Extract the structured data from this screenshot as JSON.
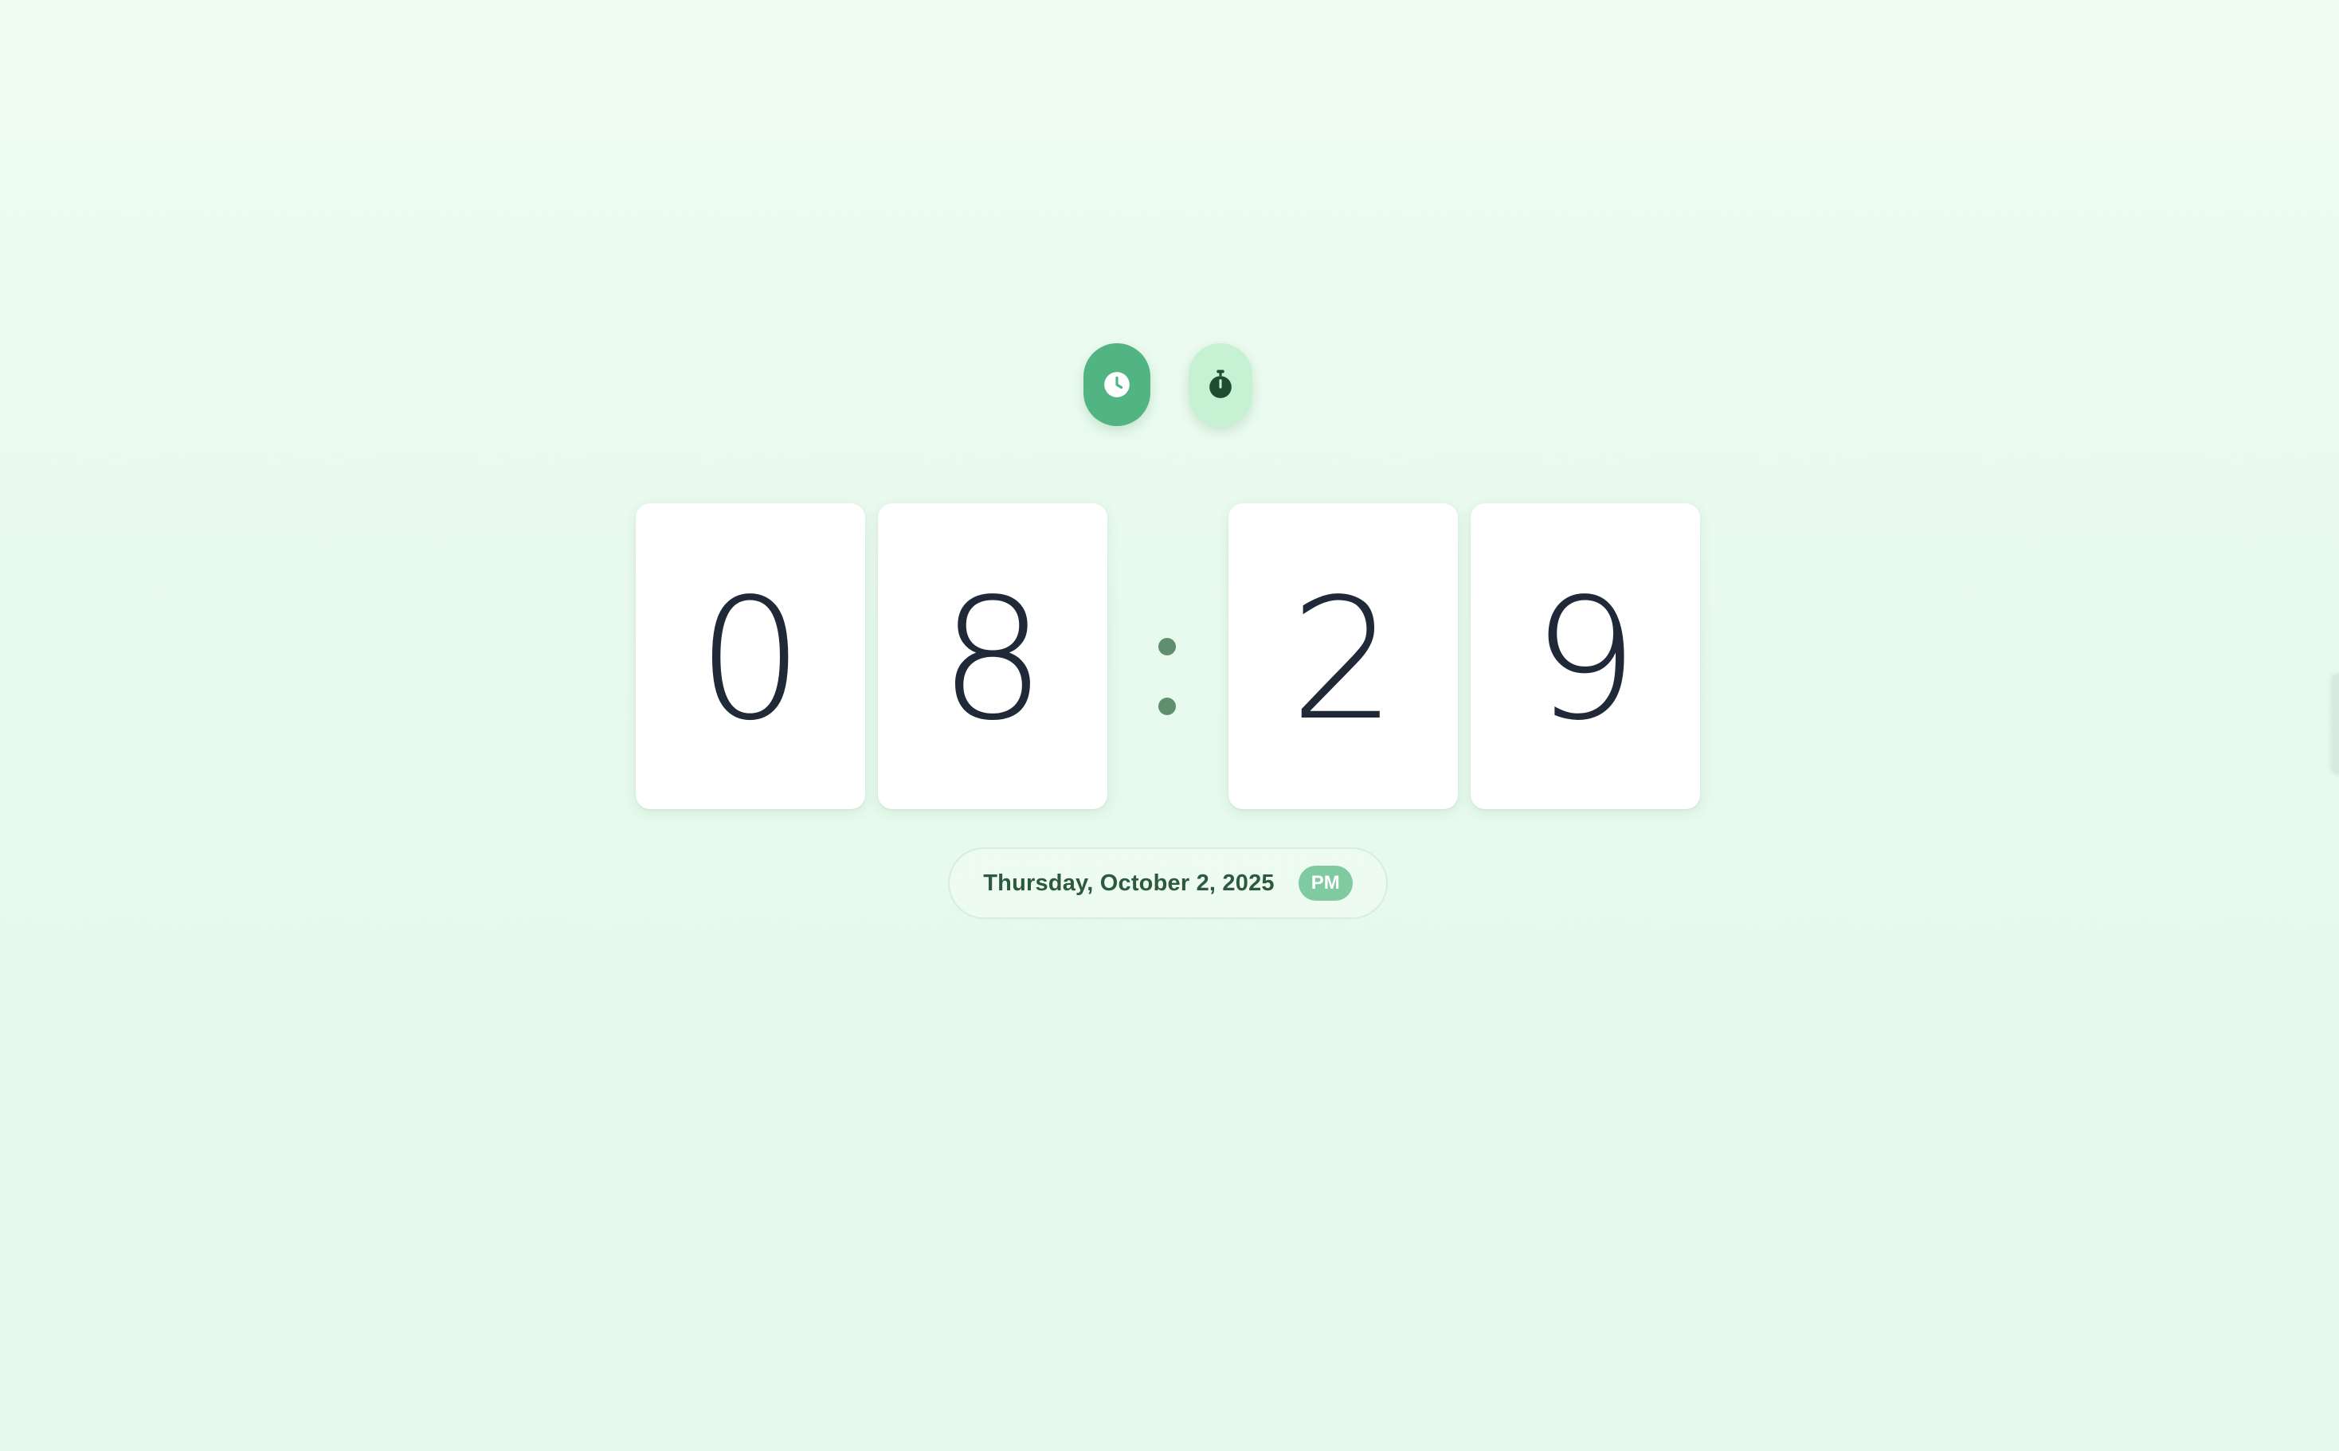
{
  "modes": {
    "clock": {
      "icon": "clock-icon",
      "active": true,
      "color": "#52b483"
    },
    "stopwatch": {
      "icon": "stopwatch-icon",
      "active": false,
      "color": "#c6f2d3"
    }
  },
  "time": {
    "digits": [
      "0",
      "8",
      "2",
      "9"
    ],
    "separator": ":",
    "period": "PM"
  },
  "date": {
    "text": "Thursday, October 2, 2025"
  },
  "colors": {
    "background": "#e8faed",
    "accent": "#52b483",
    "digit": "#1f2937",
    "date_text": "#2d5a3d",
    "badge": "#7fcaa0"
  }
}
